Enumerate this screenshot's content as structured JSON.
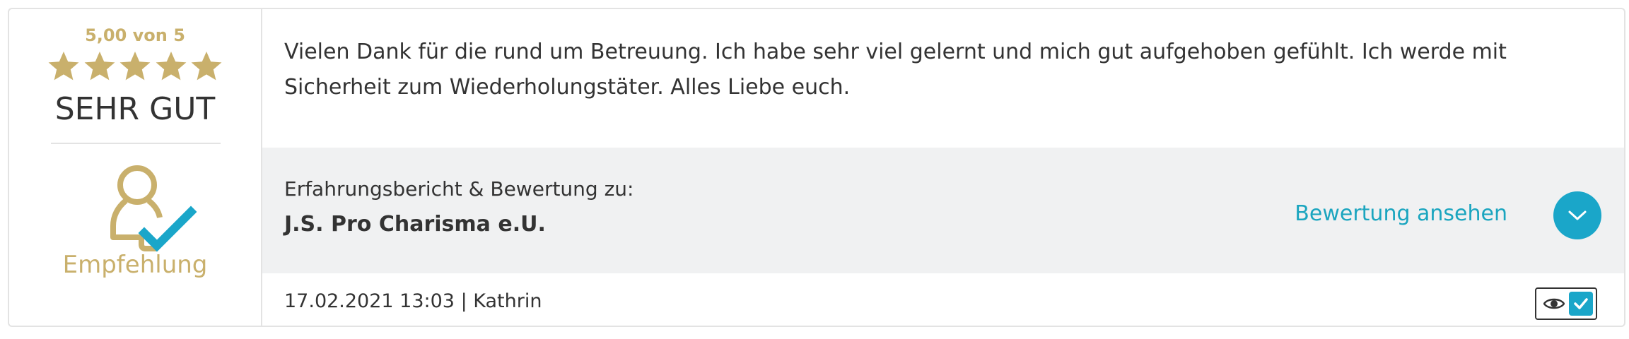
{
  "rating": {
    "score_text": "5,00 von 5",
    "stars": 5,
    "verdict": "SEHR GUT",
    "recommendation_label": "Empfehlung"
  },
  "review": {
    "text": "Vielen Dank für die rund um Betreuung. Ich habe sehr viel gelernt und mich gut aufgehoben gefühlt. Ich werde mit Sicherheit zum Wiederholungstäter. Alles Liebe euch."
  },
  "subject": {
    "label": "Erfahrungsbericht & Bewertung zu:",
    "company": "J.S. Pro Charisma e.U.",
    "view_link": "Bewertung ansehen"
  },
  "meta": {
    "date_author": "17.02.2021 13:03 | Kathrin"
  },
  "colors": {
    "gold": "#c9b06c",
    "accent": "#1aa6c9",
    "grey_panel": "#f0f1f2"
  },
  "icons": [
    "star-icon",
    "recommendation-person-check-icon",
    "chevron-down-icon",
    "eye-icon",
    "checkmark-icon"
  ]
}
